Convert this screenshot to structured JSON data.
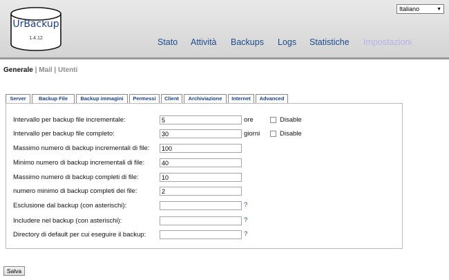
{
  "logo": {
    "title": "UrBackup",
    "version": "1.4.12"
  },
  "language": {
    "selected": "Italiano"
  },
  "nav": [
    {
      "label": "Stato",
      "active": false
    },
    {
      "label": "Attività",
      "active": false
    },
    {
      "label": "Backups",
      "active": false
    },
    {
      "label": "Logs",
      "active": false
    },
    {
      "label": "Statistiche",
      "active": false
    },
    {
      "label": "Impostazioni",
      "active": true
    }
  ],
  "subnav": {
    "general": "Generale",
    "mail": "Mail",
    "users": "Utenti",
    "separator": "|"
  },
  "tabs": [
    "Server",
    "Backup File",
    "Backup immagini",
    "Permessi",
    "Client",
    "Archiviazione",
    "Internet",
    "Advanced"
  ],
  "active_tab": "Backup File",
  "form": {
    "incr_interval": {
      "label": "Intervallo per backup file incrementale:",
      "value": "5",
      "unit": "ore",
      "disable_label": "Disable"
    },
    "full_interval": {
      "label": "Intervallo per backup file completo:",
      "value": "30",
      "unit": "giorni",
      "disable_label": "Disable"
    },
    "max_incr": {
      "label": "Massimo numero di backup incrementali di file:",
      "value": "100"
    },
    "min_incr": {
      "label": "Minimo numero di backup incrementali di file:",
      "value": "40"
    },
    "max_full": {
      "label": "Massimo numero di backup completi di file:",
      "value": "10"
    },
    "min_full": {
      "label": "numero minimo di backup completi dei file:",
      "value": "2"
    },
    "exclude": {
      "label": "Esclusione dal backup (con asterischi):",
      "value": "",
      "help": "?"
    },
    "include": {
      "label": "Includere nel backup (con asterischi):",
      "value": "",
      "help": "?"
    },
    "default_dirs": {
      "label": "Directory di default per cui eseguire il backup:",
      "value": "",
      "help": "?"
    }
  },
  "save_label": "Salva",
  "colors": {
    "link": "#1b4b8d",
    "disabled_nav": "#b3b3ea",
    "logo_text": "#1b3f8e"
  }
}
